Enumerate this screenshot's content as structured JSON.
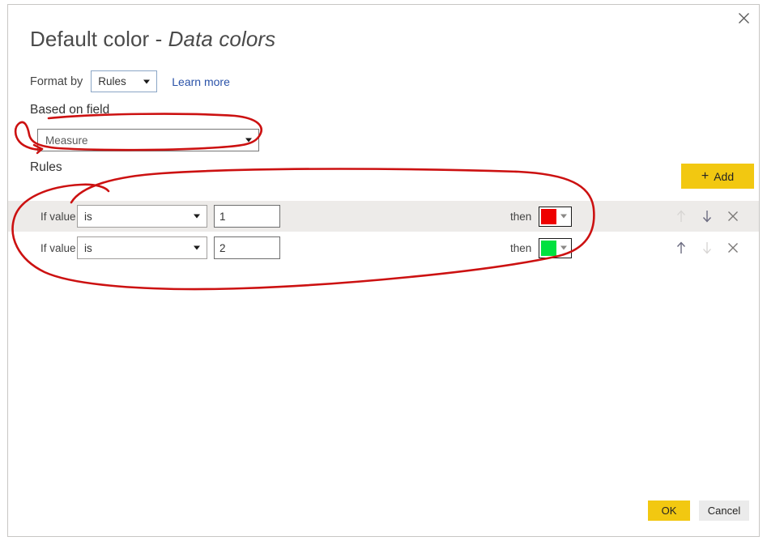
{
  "dialog": {
    "title_main": "Default color - ",
    "title_emphasis": "Data colors",
    "close_icon": "close-icon"
  },
  "format_by": {
    "label": "Format by",
    "selected": "Rules",
    "learn_more": "Learn more"
  },
  "based_on_field": {
    "label": "Based on field",
    "selected": "Measure"
  },
  "rules_section": {
    "label": "Rules",
    "add_label": "Add",
    "add_icon": "plus-icon",
    "if_value_label": "If value",
    "then_label": "then",
    "move_up_icon": "arrow-up-icon",
    "move_down_icon": "arrow-down-icon",
    "delete_icon": "close-icon",
    "rows": [
      {
        "if_value": "If value",
        "condition": "is",
        "value": "1",
        "then": "then",
        "color": "#EE0000",
        "highlighted": true
      },
      {
        "if_value": "If value",
        "condition": "is",
        "value": "2",
        "then": "then",
        "color": "#00E13F",
        "highlighted": false
      }
    ]
  },
  "footer": {
    "ok_label": "OK",
    "cancel_label": "Cancel"
  },
  "colors": {
    "accent_yellow": "#F2C811",
    "link_blue": "#2A52A8",
    "row_highlight": "#EDEBE9",
    "annotation_red": "#CC1111"
  },
  "annotations": {
    "shapes": [
      {
        "name": "ellipse-around-based-on-field"
      },
      {
        "name": "ellipse-around-rules-rows"
      }
    ]
  }
}
